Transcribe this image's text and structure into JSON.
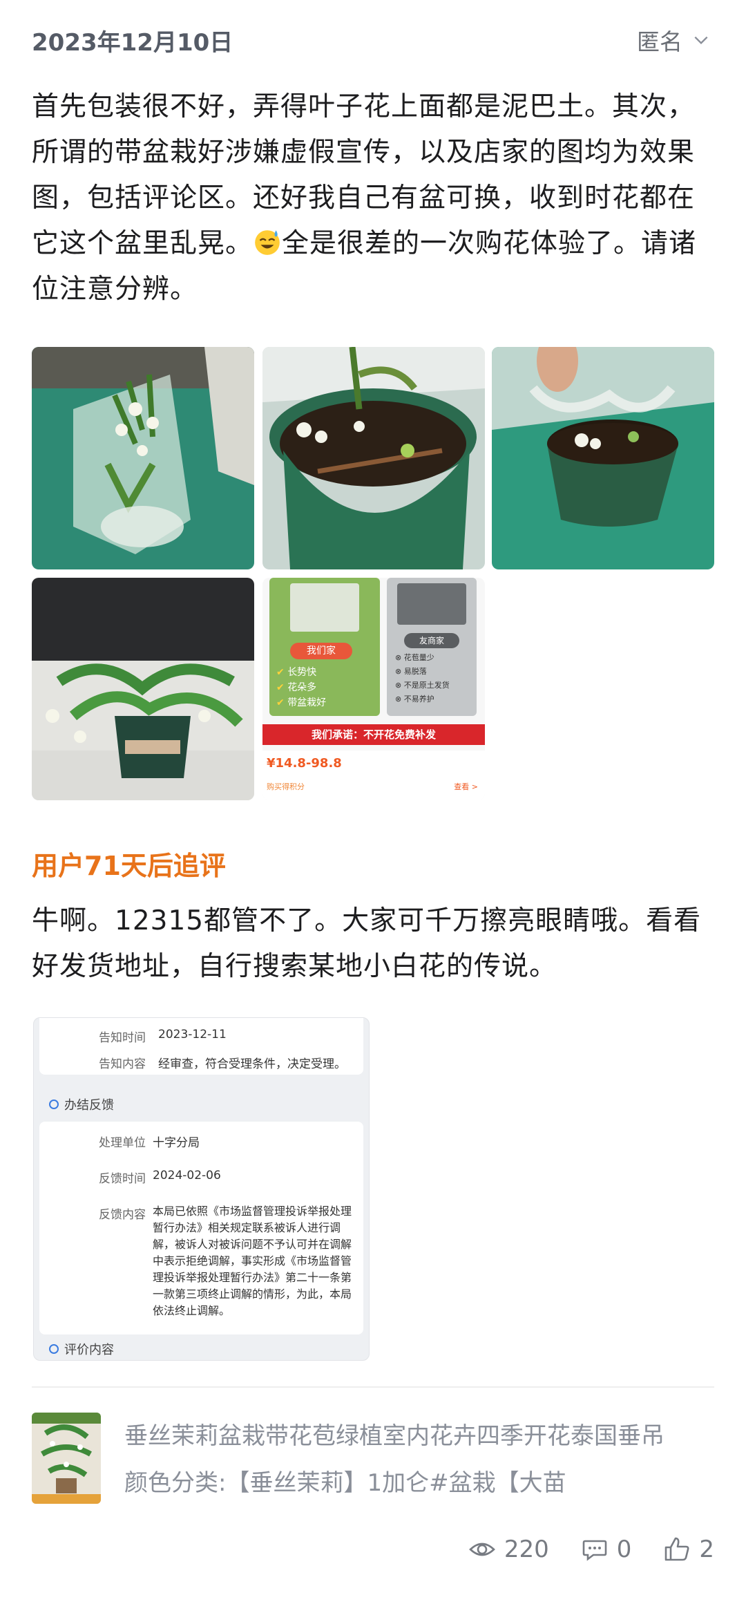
{
  "header": {
    "date": "2023年12月10日",
    "user": "匿名"
  },
  "review": {
    "text_part1": "首先包装很不好，弄得叶子花上面都是泥巴土。其次，所谓的带盆栽好涉嫌虚假宣传，以及店家的图均为效果图，包括评论区。还好我自己有盆可换，收到时花都在它这个盆里乱晃。",
    "emoji": "sweat-smile-emoji",
    "text_part2": "全是很差的一次购花体验了。请诸位注意分辨。"
  },
  "promo_image": {
    "our_shop": "我们家",
    "our_points": [
      "长势快",
      "花朵多",
      "带盆栽好"
    ],
    "other_shop": "友商家",
    "other_points": [
      "花苞量少",
      "易脱落",
      "不是原土发货",
      "不易养护"
    ],
    "promise": "我们承诺：不开花免费补发",
    "price": "¥14.8-98.8",
    "points_note": "购买得积分",
    "more": "查看 >"
  },
  "followup": {
    "title": "用户71天后追评",
    "text": "牛啊。12315都管不了。大家可千万擦亮眼睛哦。看看好发货地址，自行搜索某地小白花的传说。"
  },
  "document": {
    "notice_time_label": "告知时间",
    "notice_time": "2023-12-11",
    "notice_content_label": "告知内容",
    "notice_content": "经审查，符合受理条件，决定受理。",
    "result_section": "办结反馈",
    "unit_label": "处理单位",
    "unit": "十字分局",
    "feedback_time_label": "反馈时间",
    "feedback_time": "2024-02-06",
    "feedback_content_label": "反馈内容",
    "feedback_content": "本局已依照《市场监督管理投诉举报处理暂行办法》相关规定联系被诉人进行调解，被诉人对被诉问题不予认可并在调解中表示拒绝调解，事实形成《市场监督管理投诉举报处理暂行办法》第二十一条第一款第三项终止调解的情形，为此，本局依法终止调解。",
    "eval_section": "评价内容"
  },
  "product": {
    "title": "垂丝茉莉盆栽带花苞绿植室内花卉四季开花泰国垂吊",
    "variant": "颜色分类:【垂丝茉莉】1加仑#盆栽【大苗"
  },
  "stats": {
    "views": "220",
    "comments": "0",
    "likes": "2"
  },
  "colors": {
    "accent": "#e8731a",
    "muted": "#8a8f99"
  }
}
